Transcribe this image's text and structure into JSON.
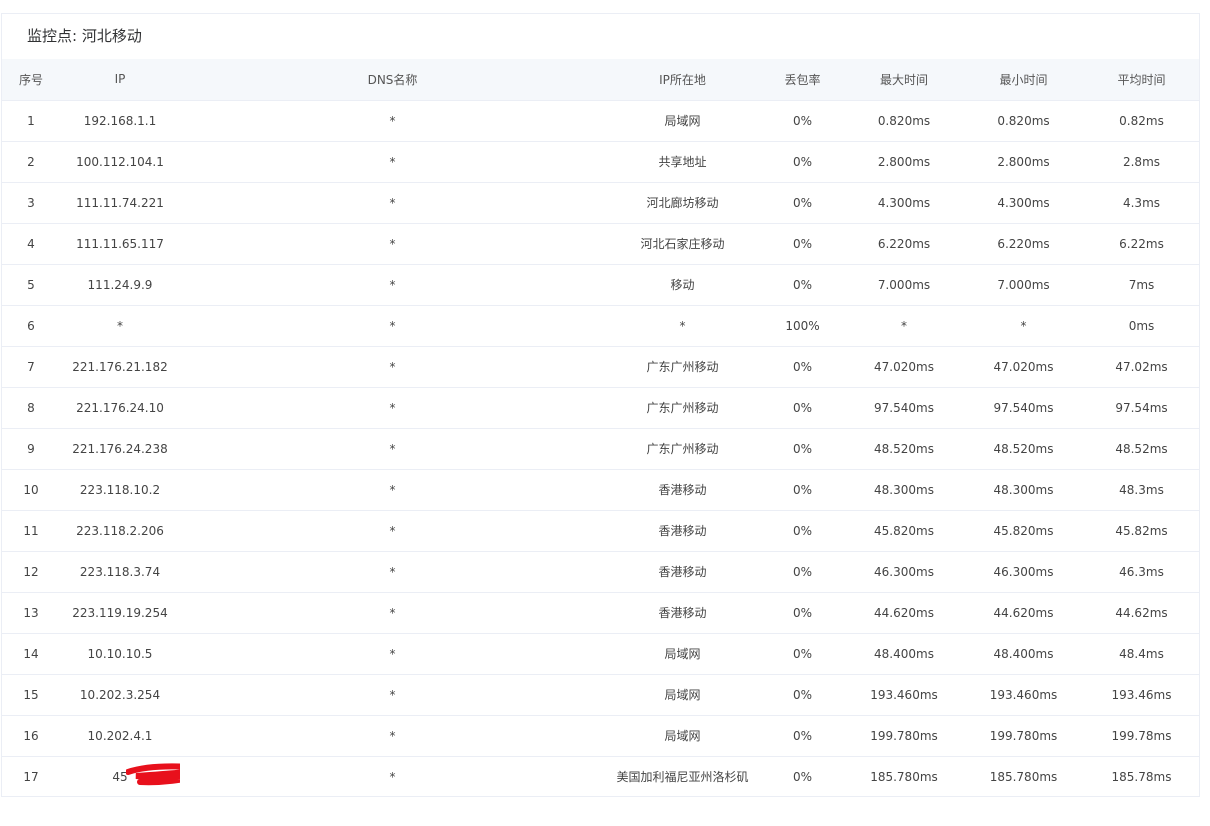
{
  "monitor": {
    "title": "监控点: 河北移动"
  },
  "table": {
    "headers": [
      "序号",
      "IP",
      "DNS名称",
      "IP所在地",
      "丢包率",
      "最大时间",
      "最小时间",
      "平均时间"
    ],
    "rows": [
      [
        "1",
        "192.168.1.1",
        "*",
        "局域网",
        "0%",
        "0.820ms",
        "0.820ms",
        "0.82ms"
      ],
      [
        "2",
        "100.112.104.1",
        "*",
        "共享地址",
        "0%",
        "2.800ms",
        "2.800ms",
        "2.8ms"
      ],
      [
        "3",
        "111.11.74.221",
        "*",
        "河北廊坊移动",
        "0%",
        "4.300ms",
        "4.300ms",
        "4.3ms"
      ],
      [
        "4",
        "111.11.65.117",
        "*",
        "河北石家庄移动",
        "0%",
        "6.220ms",
        "6.220ms",
        "6.22ms"
      ],
      [
        "5",
        "111.24.9.9",
        "*",
        "移动",
        "0%",
        "7.000ms",
        "7.000ms",
        "7ms"
      ],
      [
        "6",
        "*",
        "*",
        "*",
        "100%",
        "*",
        "*",
        "0ms"
      ],
      [
        "7",
        "221.176.21.182",
        "*",
        "广东广州移动",
        "0%",
        "47.020ms",
        "47.020ms",
        "47.02ms"
      ],
      [
        "8",
        "221.176.24.10",
        "*",
        "广东广州移动",
        "0%",
        "97.540ms",
        "97.540ms",
        "97.54ms"
      ],
      [
        "9",
        "221.176.24.238",
        "*",
        "广东广州移动",
        "0%",
        "48.520ms",
        "48.520ms",
        "48.52ms"
      ],
      [
        "10",
        "223.118.10.2",
        "*",
        "香港移动",
        "0%",
        "48.300ms",
        "48.300ms",
        "48.3ms"
      ],
      [
        "11",
        "223.118.2.206",
        "*",
        "香港移动",
        "0%",
        "45.820ms",
        "45.820ms",
        "45.82ms"
      ],
      [
        "12",
        "223.118.3.74",
        "*",
        "香港移动",
        "0%",
        "46.300ms",
        "46.300ms",
        "46.3ms"
      ],
      [
        "13",
        "223.119.19.254",
        "*",
        "香港移动",
        "0%",
        "44.620ms",
        "44.620ms",
        "44.62ms"
      ],
      [
        "14",
        "10.10.10.5",
        "*",
        "局域网",
        "0%",
        "48.400ms",
        "48.400ms",
        "48.4ms"
      ],
      [
        "15",
        "10.202.3.254",
        "*",
        "局域网",
        "0%",
        "193.460ms",
        "193.460ms",
        "193.46ms"
      ],
      [
        "16",
        "10.202.4.1",
        "*",
        "局域网",
        "0%",
        "199.780ms",
        "199.780ms",
        "199.78ms"
      ],
      [
        "17",
        "45",
        "*",
        "美国加利福尼亚州洛杉矶",
        "0%",
        "185.780ms",
        "185.780ms",
        "185.78ms"
      ]
    ]
  },
  "colors": {
    "header_bg": "#f5f8fb",
    "border": "#ebeef5",
    "redaction": "#e8101c"
  }
}
